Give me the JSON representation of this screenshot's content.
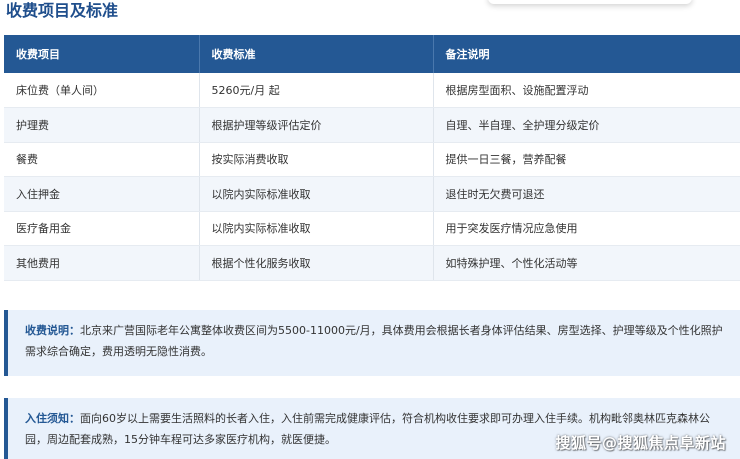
{
  "section": {
    "title": "收费项目及标准"
  },
  "table": {
    "headers": [
      "收费项目",
      "收费标准",
      "备注说明"
    ],
    "rows": [
      [
        "床位费（单人间）",
        "5260元/月 起",
        "根据房型面积、设施配置浮动"
      ],
      [
        "护理费",
        "根据护理等级评估定价",
        "自理、半自理、全护理分级定价"
      ],
      [
        "餐费",
        "按实际消费收取",
        "提供一日三餐，营养配餐"
      ],
      [
        "入住押金",
        "以院内实际标准收取",
        "退住时无欠费可退还"
      ],
      [
        "医疗备用金",
        "以院内实际标准收取",
        "用于突发医疗情况应急使用"
      ],
      [
        "其他费用",
        "根据个性化服务收取",
        "如特殊护理、个性化活动等"
      ]
    ]
  },
  "notes": {
    "fee": {
      "label": "收费说明：",
      "text": "北京来广营国际老年公寓整体收费区间为5500-11000元/月，具体费用会根据长者身体评估结果、房型选择、护理等级及个性化照护需求综合确定，费用透明无隐性消费。"
    },
    "admission": {
      "label": "入住须知：",
      "text": "面向60岁以上需要生活照料的长者入住，入住前需完成健康评估，符合机构收住要求即可办理入住手续。机构毗邻奥林匹克森林公园，周边配套成熟，15分钟车程可达多家医疗机构，就医便捷。"
    }
  },
  "watermark": "搜狐号@搜狐焦点阜新站",
  "colors": {
    "header_bg": "#245894",
    "title": "#1f4e8c",
    "note_bg": "#e9f1fb",
    "alt_row": "#f2f6fb"
  }
}
